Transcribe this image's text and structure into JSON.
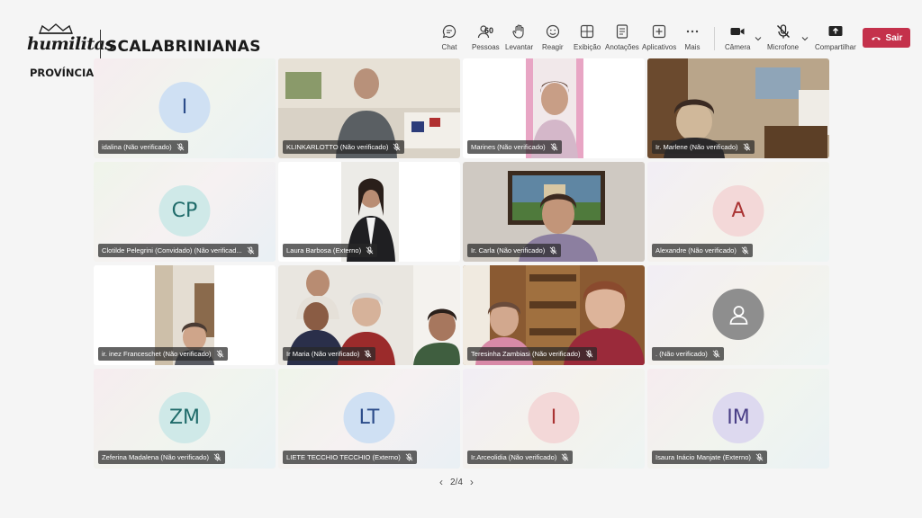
{
  "header": {
    "logo_text": "humilitas",
    "brand": "SCALABRINIANAS",
    "subtitle": "PROVÍNCIA MARIA, MÃE DOS MIGRANTES"
  },
  "toolbar": {
    "chat": "Chat",
    "people": "Pessoas",
    "people_count": "60",
    "raise": "Levantar",
    "react": "Reagir",
    "view": "Exibição",
    "notes": "Anotações",
    "apps": "Aplicativos",
    "more": "Mais",
    "camera": "Câmera",
    "mic": "Microfone",
    "share": "Compartilhar",
    "leave": "Sair"
  },
  "participants": [
    {
      "name": "idalina (Não verificado)",
      "initials": "I",
      "type": "avatar"
    },
    {
      "name": "KLINKARLOTTO (Não verificado)",
      "type": "video"
    },
    {
      "name": "Marines (Não verificado)",
      "type": "video"
    },
    {
      "name": "Ir. Marlene (Não verificado)",
      "type": "video"
    },
    {
      "name": "Clotilde Pelegrini (Convidado) (Não verificad...",
      "initials": "CP",
      "type": "avatar"
    },
    {
      "name": "Laura Barbosa (Externo)",
      "type": "video"
    },
    {
      "name": "Ir. Carla (Não verificado)",
      "type": "video"
    },
    {
      "name": "Alexandre (Não verificado)",
      "initials": "A",
      "type": "avatar"
    },
    {
      "name": "ir. inez Franceschet (Não verificado)",
      "type": "video"
    },
    {
      "name": "Ir Maria (Não verificado)",
      "type": "video"
    },
    {
      "name": "Teresinha Zambiasi (Não verificado)",
      "type": "video"
    },
    {
      "name": ". (Não verificado)",
      "type": "avatar-icon"
    },
    {
      "name": "Zeferina Madalena (Não verificado)",
      "initials": "ZM",
      "type": "avatar"
    },
    {
      "name": "LIETE TECCHIO TECCHIO (Externo)",
      "initials": "LT",
      "type": "avatar"
    },
    {
      "name": "Ir.Arceolidia (Não verificado)",
      "initials": "I",
      "type": "avatar"
    },
    {
      "name": "Isaura Inácio Manjate (Externo)",
      "initials": "IM",
      "type": "avatar"
    }
  ],
  "pagination": {
    "label": "2/4"
  },
  "colors": {
    "leave": "#c4314b",
    "background": "#f5f5f5"
  }
}
